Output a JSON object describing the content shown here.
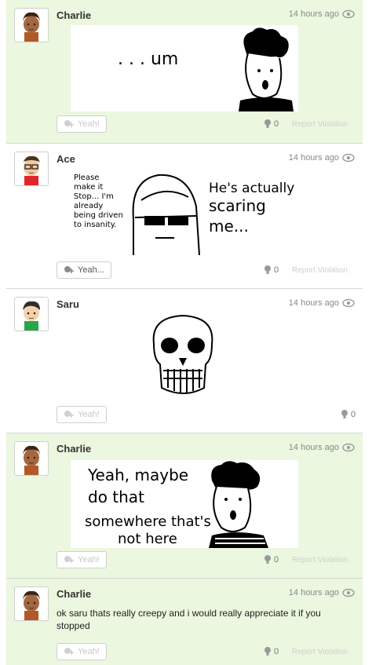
{
  "posts": [
    {
      "name": "Charlie",
      "time": "14 hours ago",
      "drawing_text": ". . . um",
      "yeah_label": "Yeah!",
      "count": "0",
      "report": "Report Violation"
    },
    {
      "name": "Ace",
      "time": "14 hours ago",
      "drawing_left_text": [
        "Please",
        "make it",
        "Stop... I'm",
        "already",
        "being driven",
        "to insanity."
      ],
      "drawing_right_text": [
        "He's actually",
        "scaring",
        "me..."
      ],
      "yeah_label": "Yeah...",
      "count": "0",
      "report": "Report Violation"
    },
    {
      "name": "Saru",
      "time": "14 hours ago",
      "yeah_label": "Yeah!",
      "count": "0"
    },
    {
      "name": "Charlie",
      "time": "14 hours ago",
      "drawing_text": [
        "Yeah, maybe",
        "do that",
        "somewhere that's",
        "not here"
      ],
      "yeah_label": "Yeah!",
      "count": "0",
      "report": "Report Violation"
    },
    {
      "name": "Charlie",
      "time": "14 hours ago",
      "body": "ok saru thats really creepy and i would really appreciate it if you stopped",
      "yeah_label": "Yeah!",
      "count": "0",
      "report": "Report Violation"
    }
  ]
}
